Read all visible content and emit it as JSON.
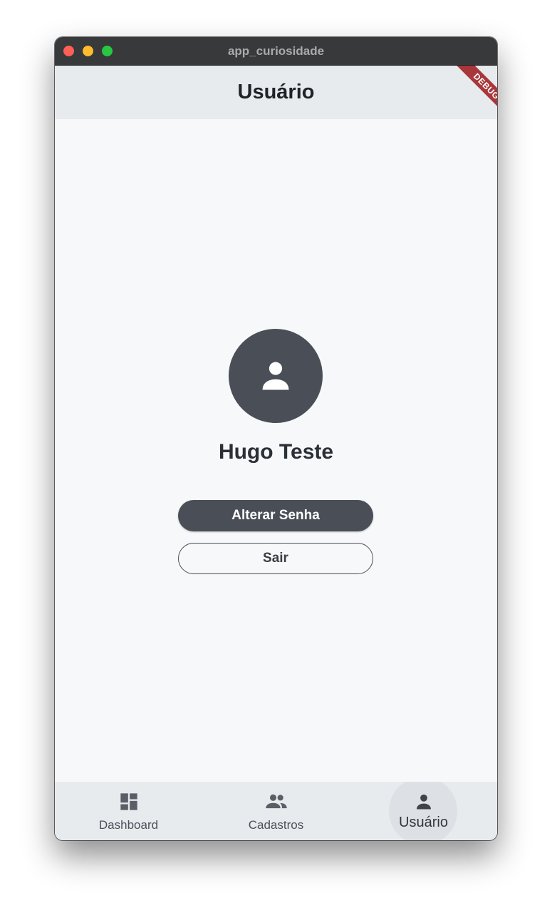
{
  "window": {
    "title": "app_curiosidade"
  },
  "appbar": {
    "title": "Usuário",
    "debug_label": "DEBUG"
  },
  "profile": {
    "avatar_icon": "person-icon",
    "name": "Hugo Teste"
  },
  "actions": {
    "change_password_label": "Alterar Senha",
    "logout_label": "Sair"
  },
  "bottom_nav": {
    "items": [
      {
        "label": "Dashboard",
        "icon": "dashboard-icon",
        "active": false
      },
      {
        "label": "Cadastros",
        "icon": "people-icon",
        "active": false
      },
      {
        "label": "Usuário",
        "icon": "person-icon",
        "active": true
      }
    ]
  },
  "colors": {
    "primary": "#4a4f57",
    "appbar_bg": "#e8ebee",
    "page_bg": "#f7f8fa",
    "debug_banner": "#a8373b"
  }
}
